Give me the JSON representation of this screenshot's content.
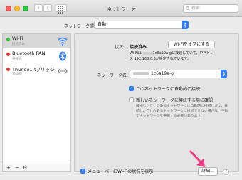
{
  "window": {
    "title": "ネットワーク"
  },
  "toolbar": {
    "back": "‹",
    "forward": "›",
    "search_placeholder": "検索"
  },
  "location": {
    "label": "ネットワーク環境:",
    "value": "自動"
  },
  "sidebar": {
    "items": [
      {
        "name": "Wi-Fi",
        "status": "接続済み",
        "state": "connected"
      },
      {
        "name": "Bluetooth PAN",
        "status": "未接続",
        "state": "disconnected"
      },
      {
        "name": "Thunde…tブリッジ",
        "status": "未接続",
        "state": "disconnected"
      }
    ],
    "add": "+",
    "remove": "−",
    "gear": "⚙"
  },
  "detail": {
    "status_label": "状況:",
    "status_value": "接続済み",
    "wifi_off_button": "Wi-Fiをオフにする",
    "description_line1": "Wi-Fiは",
    "description_line1b": "1c6a19a-gに接続していて，IPアドレ",
    "description_line2": "ス 192.168.0.3が設定されています。",
    "network_name_label": "ネットワーク名:",
    "network_name_value": "1c6a19a-g",
    "auto_join_label": "このネットワークに自動的に接続",
    "ask_join_label": "新しいネットワークに接続する前に確認",
    "ask_join_desc": "接続したことのあるネットワークに自動的に接続します。接続したことのあるネットワークに接続できない場合は，手動でネットワークを選択する必要があります。",
    "show_in_menubar_label": "メニューバーにWi-Fiの状況を表示",
    "advanced_button": "詳細...",
    "help_button": "?"
  },
  "colors": {
    "accent": "#2f7df6",
    "connected": "#2fc23b",
    "disconnected": "#e8322f",
    "annotation_arrow": "#ee3d86"
  }
}
